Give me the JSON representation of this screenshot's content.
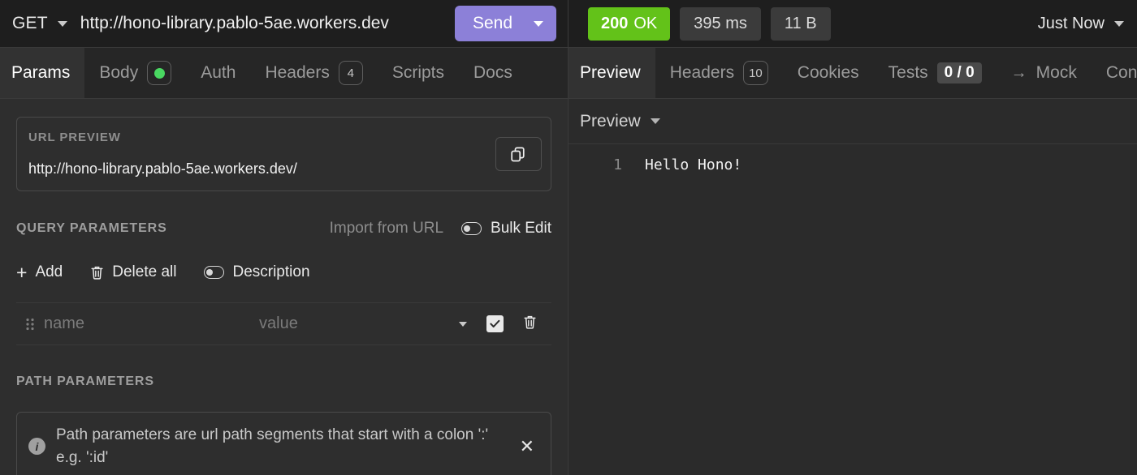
{
  "request_bar": {
    "method": "GET",
    "url": "http://hono-library.pablo-5ae.workers.dev",
    "send_label": "Send"
  },
  "response_bar": {
    "status_code": "200",
    "status_text": "OK",
    "duration": "395 ms",
    "size": "11 B",
    "time_label": "Just Now"
  },
  "request_tabs": [
    {
      "label": "Params",
      "badge": ""
    },
    {
      "label": "Body",
      "badge": "dot"
    },
    {
      "label": "Auth",
      "badge": ""
    },
    {
      "label": "Headers",
      "badge": "4"
    },
    {
      "label": "Scripts",
      "badge": ""
    },
    {
      "label": "Docs",
      "badge": ""
    }
  ],
  "response_tabs": [
    {
      "label": "Preview",
      "badge": ""
    },
    {
      "label": "Headers",
      "badge": "10"
    },
    {
      "label": "Cookies",
      "badge": ""
    },
    {
      "label": "Tests",
      "badge": "0 / 0"
    },
    {
      "label": "Mock",
      "badge": ""
    },
    {
      "label": "Con",
      "badge": ""
    }
  ],
  "url_preview": {
    "label": "URL PREVIEW",
    "value": "http://hono-library.pablo-5ae.workers.dev/"
  },
  "query_params": {
    "title": "QUERY PARAMETERS",
    "import_label": "Import from URL",
    "bulk_edit_label": "Bulk Edit",
    "add_label": "Add",
    "delete_all_label": "Delete all",
    "description_label": "Description",
    "row": {
      "name_placeholder": "name",
      "value_placeholder": "value"
    }
  },
  "path_params": {
    "title": "PATH PARAMETERS",
    "info_text": "Path parameters are url path segments that start with a colon ':' e.g. ':id'"
  },
  "preview_panel": {
    "selector_label": "Preview",
    "line_number": "1",
    "body": "Hello Hono!"
  },
  "colors": {
    "accent_send": "#8c80d8",
    "status_ok": "#63c219",
    "body_dot": "#49d861",
    "background": "#2e2e2e"
  }
}
